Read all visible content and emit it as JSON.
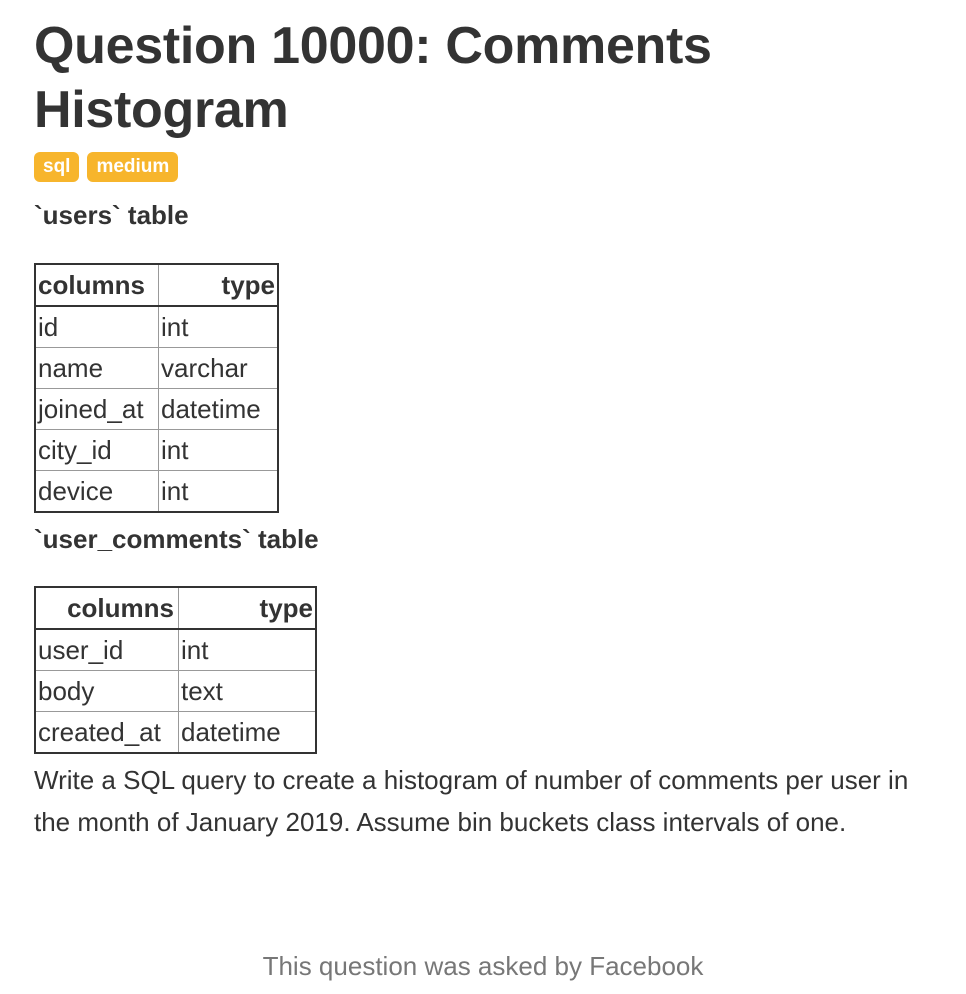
{
  "title": "Question 10000: Comments Histogram",
  "tags": [
    "sql",
    "medium"
  ],
  "colors": {
    "tag_background": "#f7b52c",
    "text": "#333333",
    "footer_text": "#777777"
  },
  "tables": [
    {
      "caption": "`users` table",
      "headers": [
        "columns",
        "type"
      ],
      "rows": [
        [
          "id",
          "int"
        ],
        [
          "name",
          "varchar"
        ],
        [
          "joined_at",
          "datetime"
        ],
        [
          "city_id",
          "int"
        ],
        [
          "device",
          "int"
        ]
      ]
    },
    {
      "caption": "`user_comments` table",
      "headers": [
        "columns",
        "type"
      ],
      "rows": [
        [
          "user_id",
          "int"
        ],
        [
          "body",
          "text"
        ],
        [
          "created_at",
          "datetime"
        ]
      ]
    }
  ],
  "prompt": "Write a SQL query to create a histogram of number of comments per user in the month of January 2019. Assume bin buckets class intervals of one.",
  "footer": "This question was asked by Facebook"
}
